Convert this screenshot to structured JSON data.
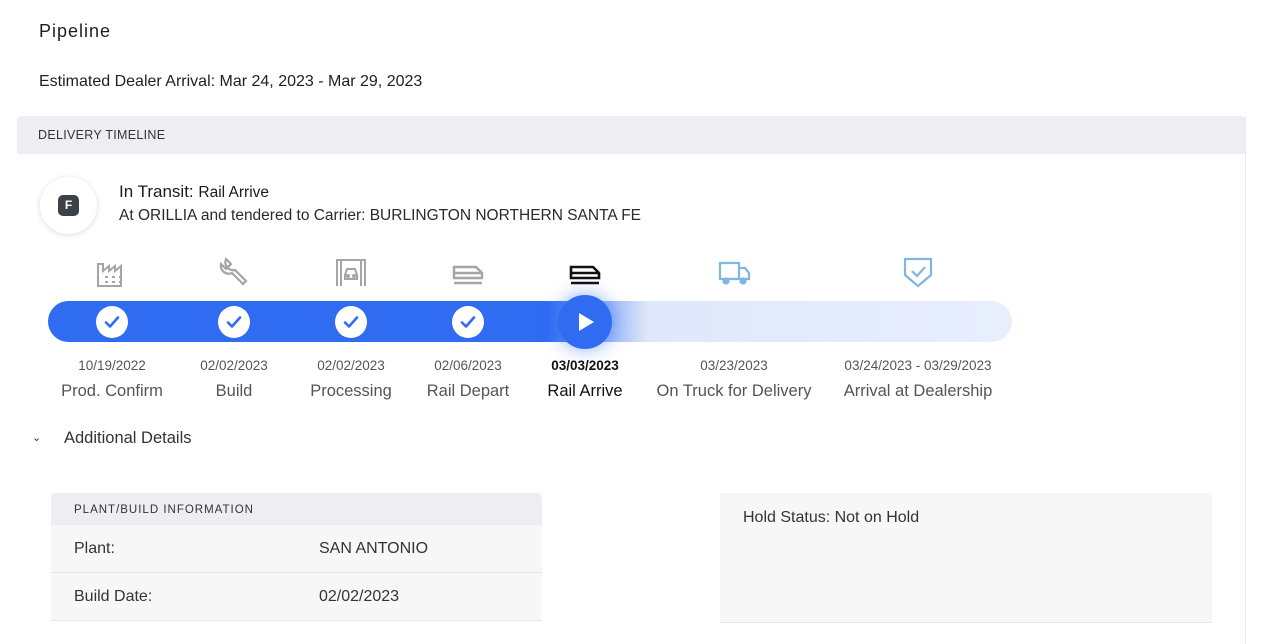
{
  "page": {
    "title": "Pipeline",
    "arrival_label": "Estimated Dealer Arrival: Mar 24, 2023 - Mar 29, 2023"
  },
  "timeline": {
    "header": "DELIVERY TIMELINE",
    "badge_letter": "F",
    "status_prefix": "In Transit:",
    "status_stage": "Rail Arrive",
    "status_detail": "At ORILLIA and tendered to Carrier: BURLINGTON NORTHERN SANTA FE",
    "progress_completed_steps": 4,
    "current_step": 5,
    "colors": {
      "accent": "#2f6cf2",
      "track_pending": "#e8eefc",
      "future_icon": "#7fb6e6"
    },
    "steps": [
      {
        "date": "10/19/2022",
        "label": "Prod. Confirm",
        "icon": "factory-icon",
        "state": "done"
      },
      {
        "date": "02/02/2023",
        "label": "Build",
        "icon": "wrench-icon",
        "state": "done"
      },
      {
        "date": "02/02/2023",
        "label": "Processing",
        "icon": "processing-icon",
        "state": "done"
      },
      {
        "date": "02/06/2023",
        "label": "Rail Depart",
        "icon": "train-depart-icon",
        "state": "done"
      },
      {
        "date": "03/03/2023",
        "label": "Rail Arrive",
        "icon": "train-arrive-icon",
        "state": "current"
      },
      {
        "date": "03/23/2023",
        "label": "On Truck for Delivery",
        "icon": "truck-icon",
        "state": "future"
      },
      {
        "date": "03/24/2023 - 03/29/2023",
        "label": "Arrival at Dealership",
        "icon": "shield-check-icon",
        "state": "future"
      }
    ]
  },
  "details": {
    "toggle_label": "Additional Details",
    "plant": {
      "header": "PLANT/BUILD INFORMATION",
      "rows": [
        {
          "key": "Plant:",
          "value": "SAN ANTONIO"
        },
        {
          "key": "Build Date:",
          "value": "02/02/2023"
        }
      ]
    },
    "hold_status": "Hold Status: Not on Hold"
  }
}
